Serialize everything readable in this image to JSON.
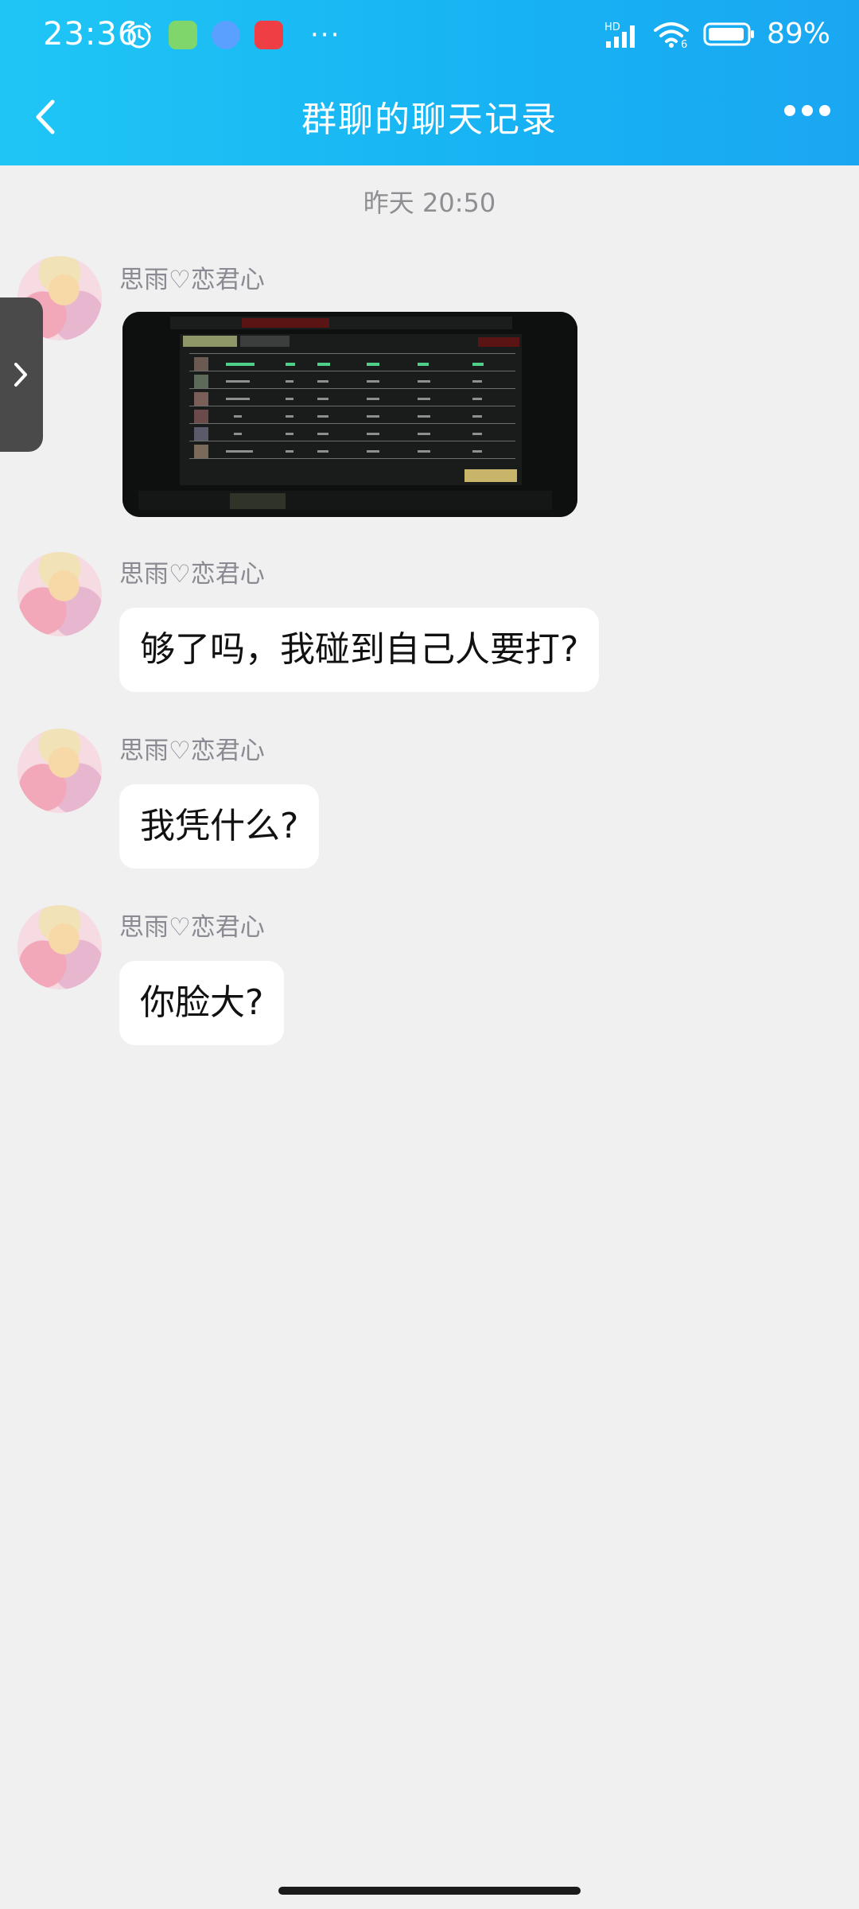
{
  "status_bar": {
    "time": "23:36",
    "more": "···",
    "network": "HD",
    "wifi_badge": "6",
    "battery": "89%"
  },
  "nav": {
    "title": "群聊的聊天记录"
  },
  "chat": {
    "timestamp": "昨天 20:50",
    "messages": [
      {
        "sender": "思雨♡恋君心",
        "type": "image"
      },
      {
        "sender": "思雨♡恋君心",
        "type": "text",
        "text": "够了吗，我碰到自己人要打?"
      },
      {
        "sender": "思雨♡恋君心",
        "type": "text",
        "text": "我凭什么?"
      },
      {
        "sender": "思雨♡恋君心",
        "type": "text",
        "text": "你脸大?"
      }
    ]
  },
  "colors": {
    "header_start": "#1fc6f5",
    "header_end": "#1aa7f2",
    "background": "#f0f0f1",
    "bubble": "#ffffff"
  }
}
